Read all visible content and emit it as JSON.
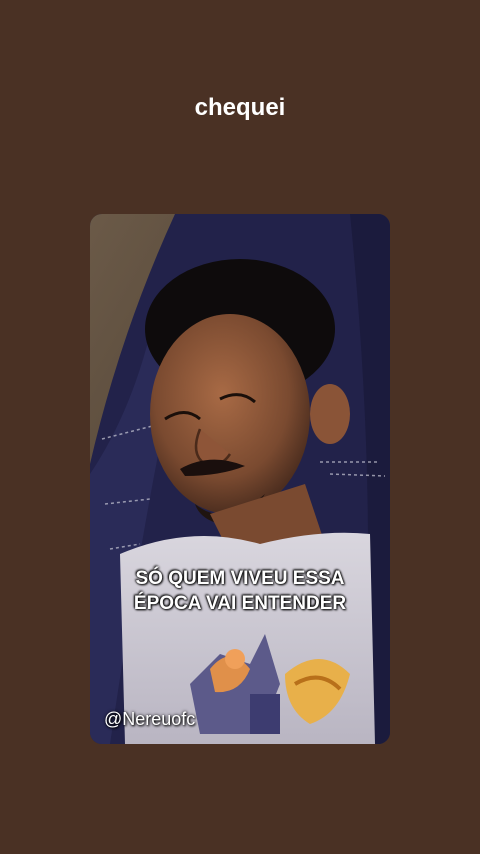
{
  "header": {
    "text": "chequei"
  },
  "media": {
    "caption_line1": "SÓ QUEM VIVEU ESSA",
    "caption_line2": "ÉPOCA VAI ENTENDER",
    "watermark": "@Nereuofc"
  }
}
